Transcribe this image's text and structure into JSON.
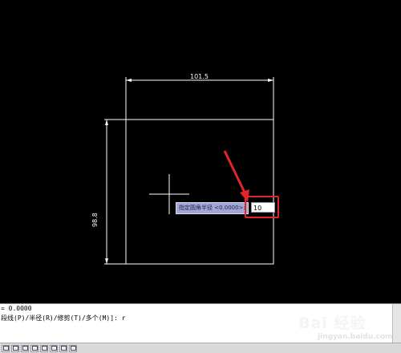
{
  "drawing": {
    "width_dimension": "101.5",
    "height_dimension": "98.8"
  },
  "prompt": {
    "tooltip": "指定圆角半径 <0.0000>:",
    "input_value": "10"
  },
  "command_line": {
    "lines": [
      "= 0.0000",
      "段线(P)/半径(R)/修剪(T)/多个(M)]: r"
    ]
  },
  "status_bar": {
    "buttons": [
      "snap-icon",
      "grid-icon",
      "ortho-icon",
      "polar-icon",
      "osnap-icon",
      "otrack-icon",
      "lineweight-icon",
      "model-icon"
    ]
  },
  "watermark": {
    "text": "Bai 经验",
    "sub": "jingyan.baidu.com"
  },
  "colors": {
    "background": "#000000",
    "lines": "#ffffff",
    "highlight": "#e0262b",
    "tooltip_bg": "#a3a7d6"
  }
}
